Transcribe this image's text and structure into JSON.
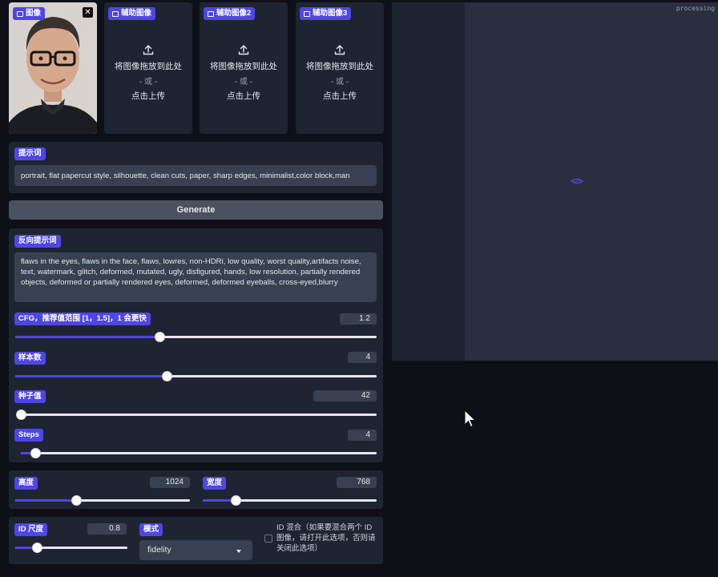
{
  "images": {
    "main_label": "图像",
    "aux1_label": "辅助图像",
    "aux2_label": "辅助图像2",
    "aux3_label": "辅助图像3",
    "drop_text": "将图像拖放到此处",
    "or_text": "- 或 -",
    "click_text": "点击上传"
  },
  "prompt": {
    "label": "提示词",
    "value": "portrait, flat papercut style, silhouette, clean cuts, paper, sharp edges, minimalist,color block,man"
  },
  "generate_label": "Generate",
  "negative": {
    "label": "反向提示词",
    "value": "flaws in the eyes, flaws in the face, flaws, lowres, non-HDRi, low quality, worst quality,artifacts noise, text, watermark, glitch, deformed, mutated, ugly, disfigured, hands, low resolution, partially rendered objects,  deformed or partially rendered eyes, deformed, deformed eyeballs, cross-eyed,blurry"
  },
  "sliders": {
    "cfg": {
      "label": "CFG，推荐值范围 [1，1.5]，1 会更快",
      "value": "1.2",
      "fraction": 0.4
    },
    "samples": {
      "label": "样本数",
      "value": "4",
      "fraction": 0.42
    },
    "seed": {
      "label": "种子值",
      "value": "42",
      "fraction": 0.0
    },
    "steps": {
      "label": "Steps",
      "value": "4",
      "fraction": 0.04
    },
    "height": {
      "label": "高度",
      "value": "1024",
      "fraction": 0.35
    },
    "width": {
      "label": "宽度",
      "value": "768",
      "fraction": 0.19
    },
    "id_scale": {
      "label": "ID 尺度",
      "value": "0.8",
      "fraction": 0.19
    }
  },
  "mode": {
    "label": "模式",
    "value": "fidelity"
  },
  "id_mix": {
    "checked": false,
    "label": "ID 混合（如果要混合两个 ID 图像，请打开此选项，否则请关闭此选项）"
  },
  "output": {
    "status": "processing"
  },
  "colors": {
    "accent": "#4f46e5",
    "panel": "#1f2433",
    "field": "#374151"
  }
}
